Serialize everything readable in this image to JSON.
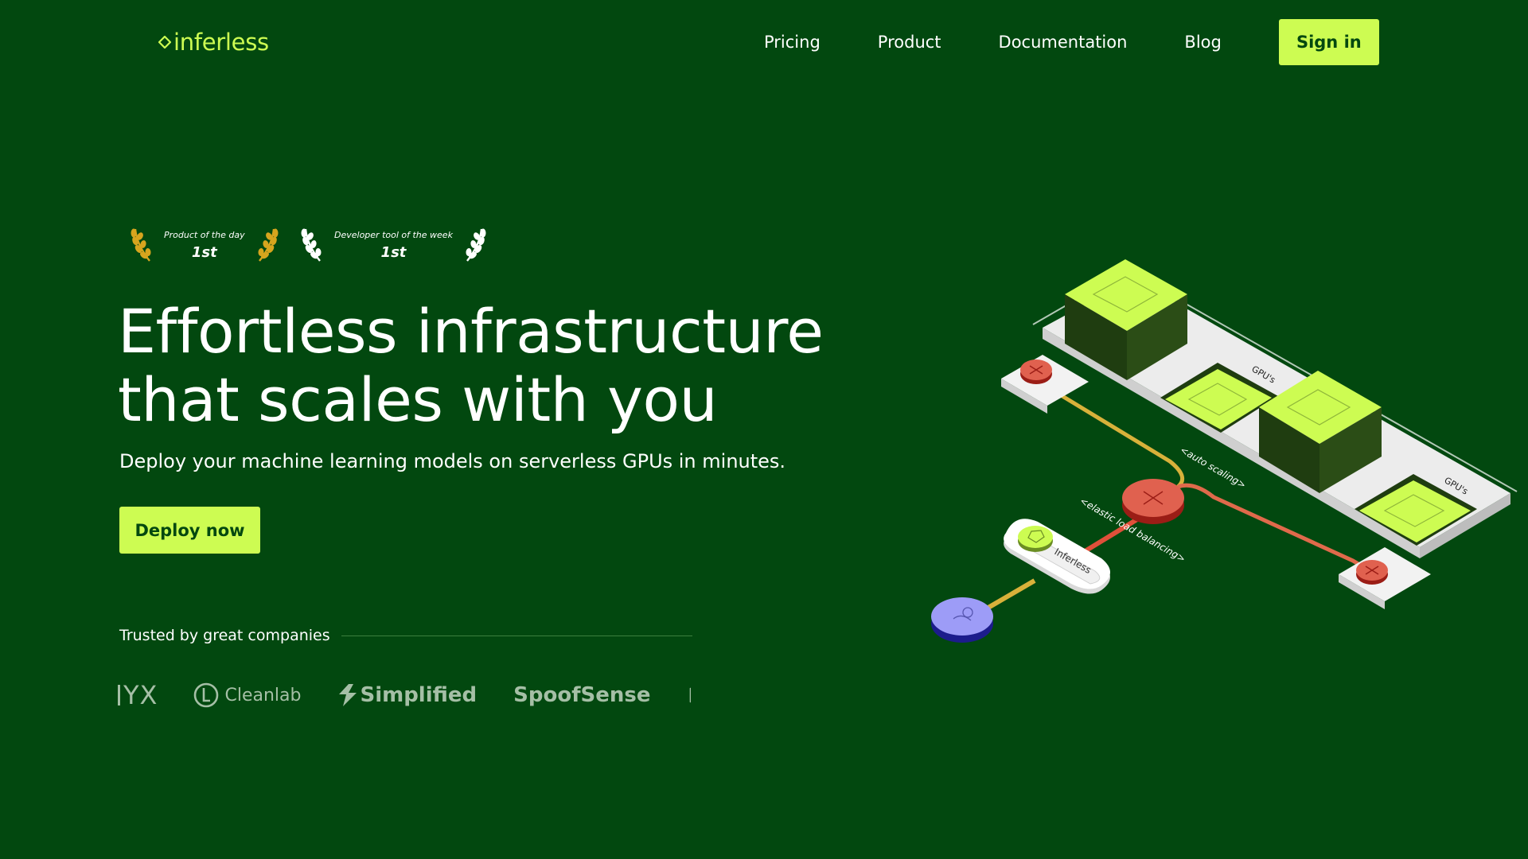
{
  "header": {
    "logo_text": "inferless",
    "nav": [
      "Pricing",
      "Product",
      "Documentation",
      "Blog"
    ],
    "sign_in_label": "Sign in"
  },
  "awards": [
    {
      "title": "Product of the day",
      "rank": "1st",
      "laurel_color": "#d6a51e"
    },
    {
      "title": "Developer tool of the week",
      "rank": "1st",
      "laurel_color": "#ffffff"
    }
  ],
  "hero": {
    "title_line1": "Effortless infrastructure",
    "title_line2": "that scales with you",
    "subtitle": "Deploy your machine learning models on serverless GPUs in minutes.",
    "cta_label": "Deploy now"
  },
  "trusted": {
    "label": "Trusted by great companies",
    "logos": [
      "YX",
      "Cleanlab",
      "Simplified",
      "SpoofSense"
    ]
  },
  "illustration": {
    "labels": {
      "gpus_1": "GPU's",
      "gpus_2": "GPU's",
      "auto_scaling": "<auto scaling>",
      "load_balancing": "<elastic load balancing>",
      "inferless": "Inferless"
    }
  },
  "colors": {
    "background": "#02480f",
    "accent": "#cdfc52",
    "node_red": "#e0614f",
    "client_purple": "#9d9cf7"
  }
}
